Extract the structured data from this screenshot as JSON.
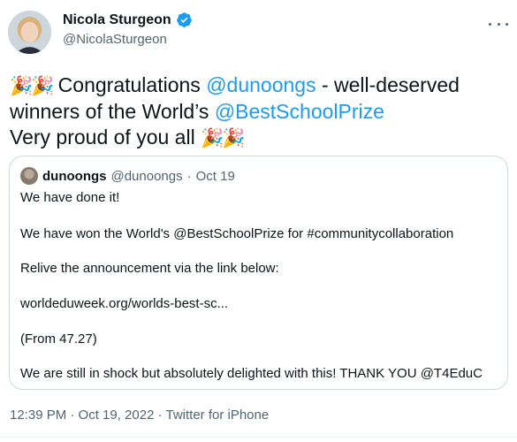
{
  "author": {
    "name": "Nicola Sturgeon",
    "handle": "@NicolaSturgeon",
    "verified": true,
    "avatar_icon": "profile-photo"
  },
  "tweet": {
    "emoji": "🎉🎉",
    "line1_text": " Congratulations ",
    "mention1": "@dunoongs",
    "line1_tail": " - well-deserved",
    "line2_text": "winners of the World’s ",
    "mention2": "@BestSchoolPrize",
    "line3_text": "Very proud of you all ",
    "emoji_end": "🎉🎉"
  },
  "quote": {
    "name": "dunoongs",
    "handle": "@dunoongs",
    "separator": "·",
    "date": "Oct 19",
    "lines": [
      "We have done it!",
      "We have won the World's @BestSchoolPrize for #communitycollaboration",
      "Relive the announcement via the link below:",
      "worldeduweek.org/worlds-best-sc...",
      "(From 47.27)",
      "We are still in shock but absolutely delighted with this! THANK YOU @T4EduC"
    ]
  },
  "meta": {
    "text": "12:39 PM · Oct 19, 2022 · Twitter for iPhone"
  },
  "colors": {
    "link": "#1d9bf0",
    "secondary_text": "#536471",
    "border": "#cfd9de",
    "verified": "#1d9bf0"
  }
}
